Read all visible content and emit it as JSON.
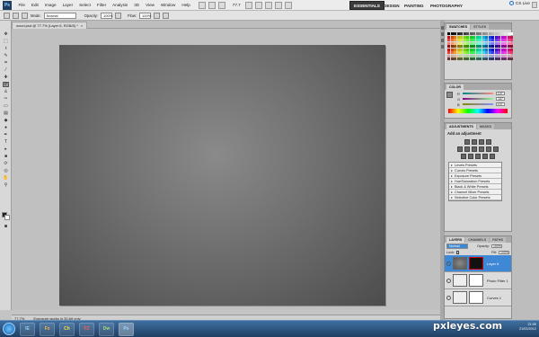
{
  "menubar": {
    "logo": "Ps",
    "items": [
      "File",
      "Edit",
      "Image",
      "Layer",
      "Select",
      "Filter",
      "Analysis",
      "3D",
      "View",
      "Window",
      "Help"
    ],
    "zoom": "77.7",
    "workspaces": [
      "ESSENTIALS",
      "DESIGN",
      "PAINTING",
      "PHOTOGRAPHY"
    ],
    "cs_live": "CS Live"
  },
  "options": {
    "mode_label": "Mode:",
    "mode_value": "Normal",
    "opacity_label": "Opacity:",
    "opacity_value": "100%",
    "flow_label": "Flow:",
    "flow_value": "100%"
  },
  "document": {
    "tab_title": "wood.psd @ 77.7% (Layer 6, RGB/8) *"
  },
  "status": {
    "zoom": "77.7%",
    "info": "Exposure works in 32-bit only"
  },
  "panels": {
    "swatches_tabs": [
      "SWATCHES",
      "STYLES"
    ],
    "color_tab": "COLOR",
    "rgb": [
      "R",
      "G",
      "B"
    ],
    "rgb_values": [
      "137",
      "137",
      "137"
    ],
    "adjustments_tabs": [
      "ADJUSTMENTS",
      "MASKS"
    ],
    "add_adjustment": "Add an adjustment",
    "presets": [
      "Levels Presets",
      "Curves Presets",
      "Exposure Presets",
      "Hue/Saturation Presets",
      "Black & White Presets",
      "Channel Mixer Presets",
      "Selective Color Presets"
    ],
    "layers_tabs": [
      "LAYERS",
      "CHANNELS",
      "PATHS"
    ],
    "blend_mode": "Normal",
    "opacity_label": "Opacity:",
    "opacity_value": "100%",
    "fill_label": "Fill:",
    "fill_value": "100%",
    "lock_label": "Lock:",
    "layers": [
      {
        "name": "Layer 6",
        "selected": true
      },
      {
        "name": "Photo Filter 1",
        "selected": false
      },
      {
        "name": "Curves 1",
        "selected": false
      }
    ]
  },
  "taskbar": {
    "apps": [
      "IE",
      "Fx",
      "Ch",
      "FZ",
      "Dw",
      "Ps"
    ],
    "time": "21:00",
    "date": "21/02/2012"
  },
  "watermark": "pxleyes.com",
  "colors": {
    "selection_blue": "#3f88d6",
    "workspace_active": "#3c3c3c",
    "taskbar": "#2b5583"
  }
}
